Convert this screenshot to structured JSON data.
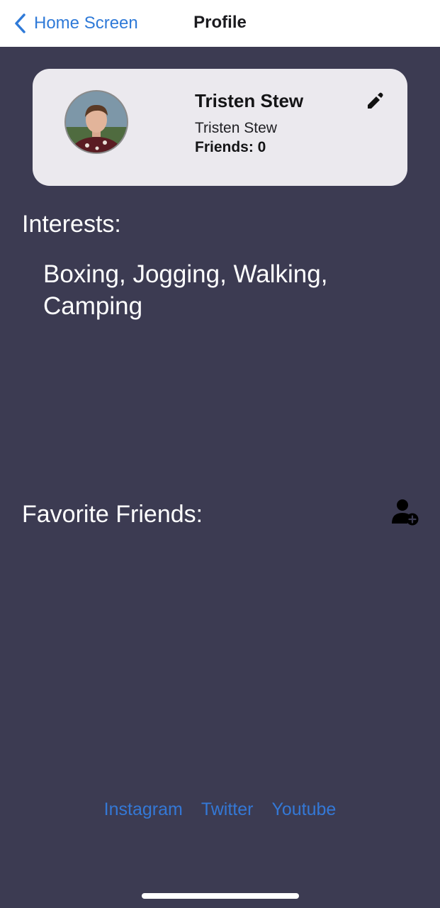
{
  "navbar": {
    "back_label": "Home Screen",
    "title": "Profile"
  },
  "profile": {
    "name": "Tristen Stew",
    "username": "Tristen Stew",
    "friends": "Friends: 0",
    "edit_icon": "pencil-icon",
    "avatar_icon": "avatar-photo"
  },
  "interests": {
    "heading": "Interests:",
    "text": "Boxing, Jogging, Walking, Camping"
  },
  "favorite_friends": {
    "heading": "Favorite Friends:",
    "add_icon": "add-friend-icon"
  },
  "social": {
    "links": [
      "Instagram",
      "Twitter",
      "Youtube"
    ]
  },
  "colors": {
    "background": "#3c3b52",
    "card": "#ebe9ee",
    "link": "#3478d6",
    "navbar": "#ffffff"
  }
}
